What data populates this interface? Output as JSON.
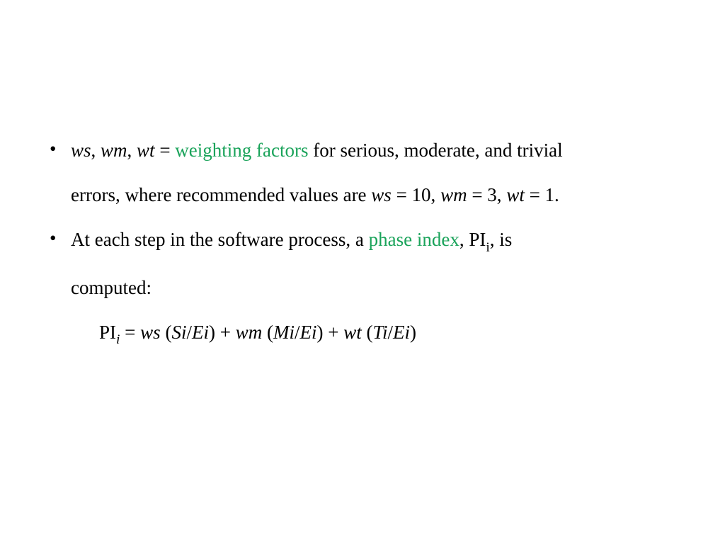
{
  "colors": {
    "highlight": "#1aa35a"
  },
  "bullets": [
    {
      "lines": [
        [
          {
            "t": "ws",
            "i": true
          },
          {
            "t": ", "
          },
          {
            "t": "wm",
            "i": true
          },
          {
            "t": ", "
          },
          {
            "t": "wt",
            "i": true
          },
          {
            "t": " = "
          },
          {
            "t": "weighting factors",
            "g": true
          },
          {
            "t": " for serious, moderate, and trivial"
          }
        ],
        [
          {
            "t": "errors, where recommended values are "
          },
          {
            "t": "ws",
            "i": true
          },
          {
            "t": " = 10, "
          },
          {
            "t": "wm",
            "i": true
          },
          {
            "t": " = 3, "
          },
          {
            "t": "wt",
            "i": true
          },
          {
            "t": " = 1."
          }
        ]
      ]
    },
    {
      "lines": [
        [
          {
            "t": "At each step in the software process, a "
          },
          {
            "t": "phase index",
            "g": true
          },
          {
            "t": ", PI"
          },
          {
            "t": "i",
            "sub": true
          },
          {
            "t": ", is"
          }
        ],
        [
          {
            "t": "computed:"
          }
        ]
      ],
      "formula": [
        {
          "t": "PI"
        },
        {
          "t": "i",
          "i": true,
          "sub": true
        },
        {
          "t": " = "
        },
        {
          "t": "ws",
          "i": true
        },
        {
          "t": " ("
        },
        {
          "t": "Si",
          "i": true
        },
        {
          "t": "/"
        },
        {
          "t": "Ei",
          "i": true
        },
        {
          "t": ") + "
        },
        {
          "t": "wm",
          "i": true
        },
        {
          "t": " ("
        },
        {
          "t": "Mi",
          "i": true
        },
        {
          "t": "/"
        },
        {
          "t": "Ei",
          "i": true
        },
        {
          "t": ") + "
        },
        {
          "t": "wt",
          "i": true
        },
        {
          "t": " ("
        },
        {
          "t": "Ti",
          "i": true
        },
        {
          "t": "/"
        },
        {
          "t": "Ei",
          "i": true
        },
        {
          "t": ")"
        }
      ]
    }
  ]
}
